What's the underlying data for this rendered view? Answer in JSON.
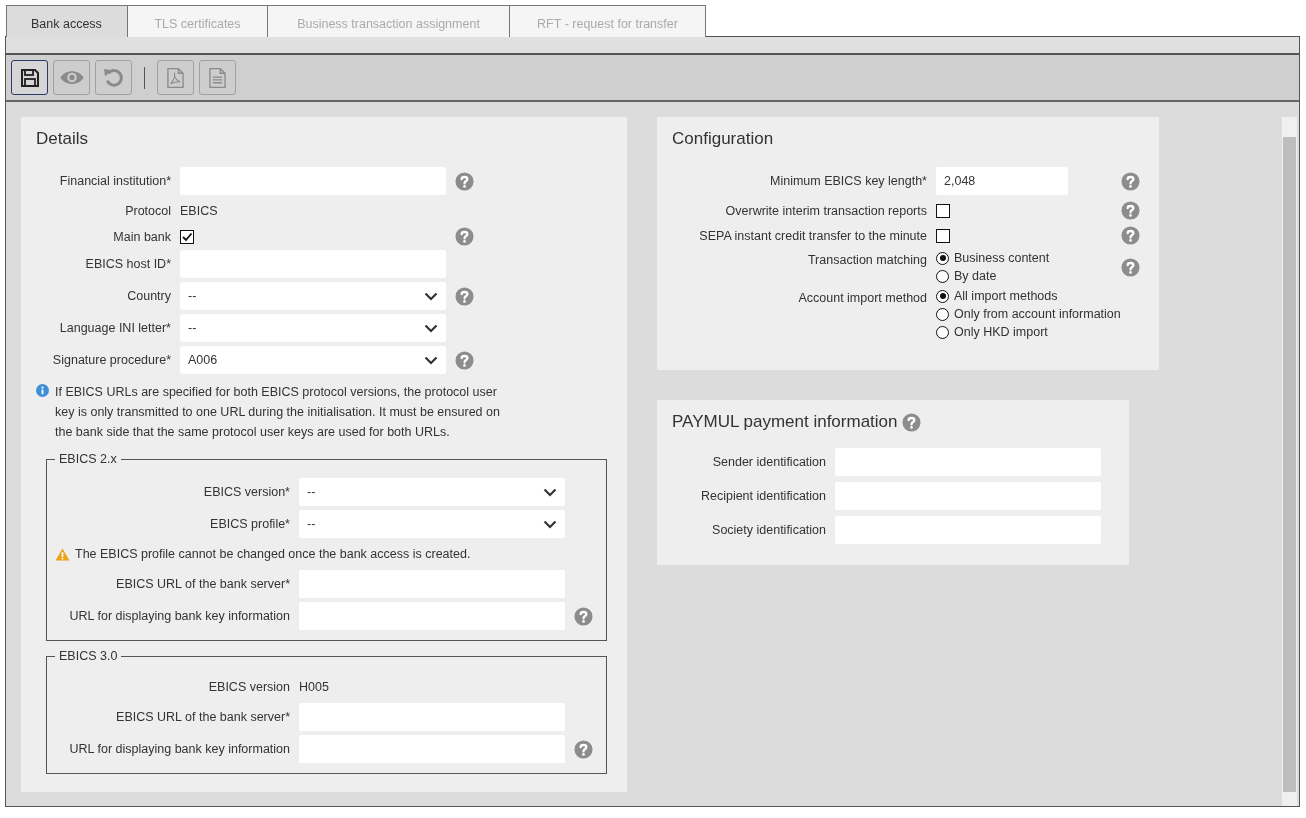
{
  "tabs": [
    {
      "label": "Bank access",
      "selected": true
    },
    {
      "label": "TLS certificates",
      "selected": false
    },
    {
      "label": "Business transaction assignment",
      "selected": false
    },
    {
      "label": "RFT - request for transfer",
      "selected": false
    }
  ],
  "toolbar": [
    {
      "kind": "save",
      "disabled": false
    },
    {
      "kind": "preview",
      "disabled": true
    },
    {
      "kind": "undo",
      "disabled": true
    },
    {
      "kind": "separator"
    },
    {
      "kind": "pdf",
      "disabled": true
    },
    {
      "kind": "document",
      "disabled": true
    }
  ],
  "details": {
    "title": "Details",
    "rows": [
      {
        "kind": "input",
        "label": "Financial institution*",
        "value": "",
        "help": true
      },
      {
        "kind": "static",
        "label": "Protocol",
        "value": "EBICS",
        "help": false
      },
      {
        "kind": "checkbox",
        "label": "Main bank",
        "checked": true,
        "help": true
      },
      {
        "kind": "input",
        "label": "EBICS host ID*",
        "value": "",
        "help": false
      },
      {
        "kind": "select",
        "label": "Country",
        "value": "--",
        "help": true
      },
      {
        "kind": "select",
        "label": "Language INI letter*",
        "value": "--",
        "help": false
      },
      {
        "kind": "select",
        "label": "Signature procedure*",
        "value": "A006",
        "help": true
      }
    ],
    "info": "If EBICS URLs are specified for both EBICS protocol versions, the protocol user key is only transmitted to one URL during the initialisation. It must be ensured on the bank side that the same protocol user keys are used for both URLs.",
    "groups": [
      {
        "title": "EBICS 2.x",
        "rows": [
          {
            "kind": "select",
            "label": "EBICS version*",
            "value": "--",
            "help": false
          },
          {
            "kind": "select",
            "label": "EBICS profile*",
            "value": "--",
            "help": false
          },
          {
            "kind": "warning",
            "text": "The EBICS profile cannot be changed once the bank access is created."
          },
          {
            "kind": "input",
            "label": "EBICS URL of the bank server*",
            "value": "",
            "help": false
          },
          {
            "kind": "input",
            "label": "URL for displaying bank key information",
            "value": "",
            "help": true
          }
        ]
      },
      {
        "title": "EBICS 3.0",
        "rows": [
          {
            "kind": "static",
            "label": "EBICS version",
            "value": "H005",
            "help": false
          },
          {
            "kind": "input",
            "label": "EBICS URL of the bank server*",
            "value": "",
            "help": false
          },
          {
            "kind": "input",
            "label": "URL for displaying bank key information",
            "value": "",
            "help": true
          }
        ]
      }
    ]
  },
  "configuration": {
    "title": "Configuration",
    "rows": [
      {
        "kind": "input",
        "label": "Minimum EBICS key length*",
        "value": "2,048",
        "help": true
      },
      {
        "kind": "checkbox",
        "label": "Overwrite interim transaction reports",
        "checked": false,
        "help": true
      },
      {
        "kind": "checkbox",
        "label": "SEPA instant credit transfer to the minute",
        "checked": false,
        "help": true
      },
      {
        "kind": "radio",
        "label": "Transaction matching",
        "help": true,
        "options": [
          {
            "label": "Business content",
            "selected": true
          },
          {
            "label": "By date",
            "selected": false
          }
        ]
      },
      {
        "kind": "radio",
        "label": "Account import method",
        "help": false,
        "options": [
          {
            "label": "All import methods",
            "selected": true
          },
          {
            "label": "Only from account information",
            "selected": false
          },
          {
            "label": "Only HKD import",
            "selected": false
          }
        ]
      }
    ]
  },
  "paymul": {
    "title": "PAYMUL payment information",
    "help": true,
    "rows": [
      {
        "kind": "input",
        "label": "Sender identification",
        "value": "",
        "help": false
      },
      {
        "kind": "input",
        "label": "Recipient identification",
        "value": "",
        "help": false
      },
      {
        "kind": "input",
        "label": "Society identification",
        "value": "",
        "help": false
      }
    ]
  }
}
